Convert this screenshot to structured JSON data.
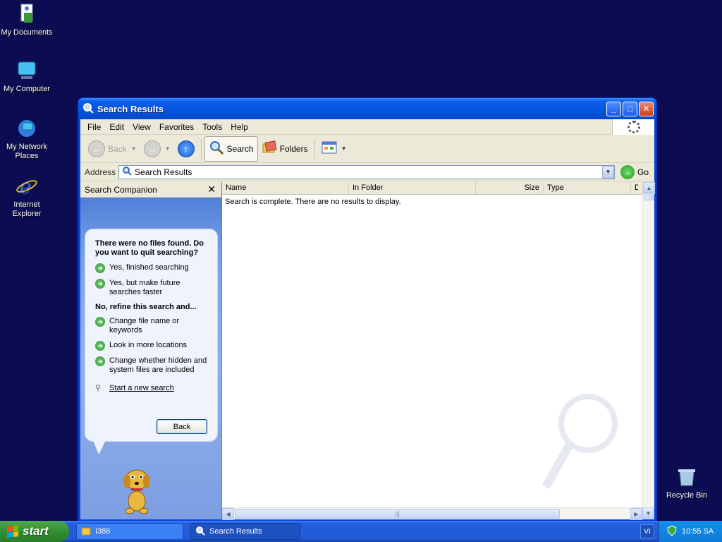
{
  "desktop": {
    "icons": [
      {
        "label": "My Documents"
      },
      {
        "label": "My Computer"
      },
      {
        "label": "My Network Places"
      },
      {
        "label": "Internet Explorer"
      },
      {
        "label": "Recycle Bin"
      }
    ]
  },
  "window": {
    "title": "Search Results",
    "menu": [
      "File",
      "Edit",
      "View",
      "Favorites",
      "Tools",
      "Help"
    ],
    "toolbar": {
      "back": "Back",
      "search": "Search",
      "folders": "Folders"
    },
    "address": {
      "label": "Address",
      "value": "Search Results",
      "go": "Go"
    },
    "companion": {
      "title": "Search Companion",
      "question": "There were no files found. Do you want to quit searching?",
      "options_quit": [
        "Yes, finished searching",
        "Yes, but make future searches faster"
      ],
      "refine_heading": "No, refine this search and...",
      "options_refine": [
        "Change file name or keywords",
        "Look in more locations",
        "Change whether hidden and system files are included"
      ],
      "new_search": "Start a new search",
      "back_button": "Back"
    },
    "results": {
      "columns": [
        "Name",
        "In Folder",
        "Size",
        "Type",
        "D"
      ],
      "message": "Search is complete. There are no results to display."
    }
  },
  "taskbar": {
    "start": "start",
    "items": [
      "I386",
      "Search Results"
    ],
    "lang": "VI",
    "time": "10:55 SA"
  },
  "colors": {
    "desktop": "#0c0c52",
    "titlebar": "#0454e0",
    "taskbar": "#245edc",
    "start": "#2f8a2f"
  }
}
